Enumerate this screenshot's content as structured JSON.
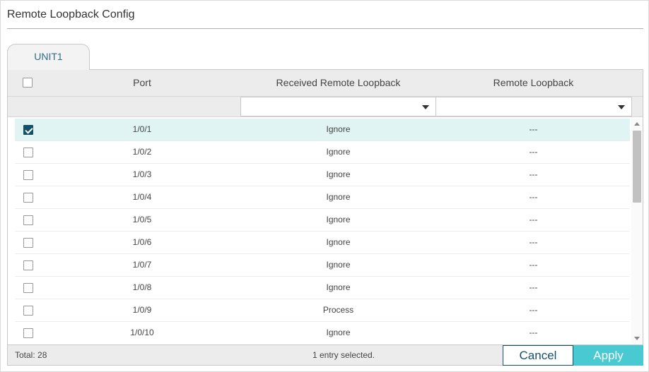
{
  "page": {
    "title": "Remote Loopback Config"
  },
  "tabs": [
    {
      "label": "UNIT1",
      "active": true
    }
  ],
  "table": {
    "columns": {
      "port": "Port",
      "received": "Received Remote Loopback",
      "remote": "Remote Loopback"
    },
    "filters": {
      "received_value": "",
      "remote_value": ""
    },
    "rows": [
      {
        "port": "1/0/1",
        "received": "Ignore",
        "remote": "---",
        "checked": true
      },
      {
        "port": "1/0/2",
        "received": "Ignore",
        "remote": "---",
        "checked": false
      },
      {
        "port": "1/0/3",
        "received": "Ignore",
        "remote": "---",
        "checked": false
      },
      {
        "port": "1/0/4",
        "received": "Ignore",
        "remote": "---",
        "checked": false
      },
      {
        "port": "1/0/5",
        "received": "Ignore",
        "remote": "---",
        "checked": false
      },
      {
        "port": "1/0/6",
        "received": "Ignore",
        "remote": "---",
        "checked": false
      },
      {
        "port": "1/0/7",
        "received": "Ignore",
        "remote": "---",
        "checked": false
      },
      {
        "port": "1/0/8",
        "received": "Ignore",
        "remote": "---",
        "checked": false
      },
      {
        "port": "1/0/9",
        "received": "Process",
        "remote": "---",
        "checked": false
      },
      {
        "port": "1/0/10",
        "received": "Ignore",
        "remote": "---",
        "checked": false
      }
    ]
  },
  "footer": {
    "total": "Total: 28",
    "selection": "1 entry selected.",
    "cancel_label": "Cancel",
    "apply_label": "Apply"
  },
  "colors": {
    "accent": "#49c9d1",
    "primary_dark": "#14506a",
    "selected_row": "#dff4f3",
    "tab_text": "#2c6e84"
  }
}
